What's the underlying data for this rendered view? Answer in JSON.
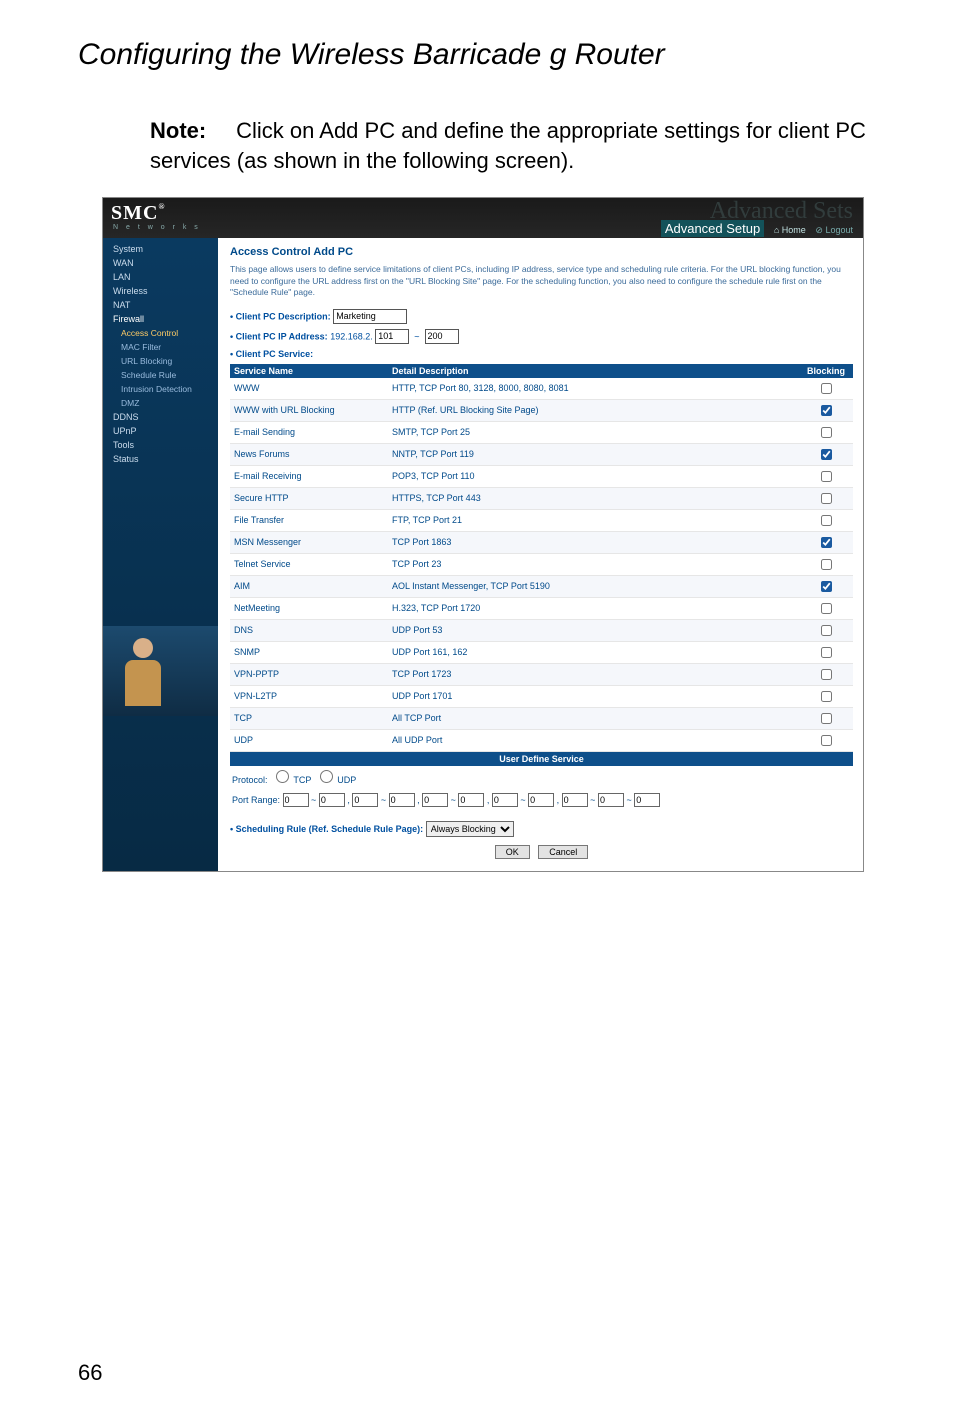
{
  "page": {
    "title": "Configuring the Wireless Barricade g Router",
    "note_label": "Note:",
    "note_text": "Click on Add PC and define the appropriate settings for client PC services (as shown in the following screen).",
    "page_number": "66"
  },
  "header": {
    "logo": "SMC",
    "logo_sup": "®",
    "networks": "N e t w o r k s",
    "ghost": "Advanced Sets",
    "setup": "Advanced Setup",
    "home": "Home",
    "logout": "Logout"
  },
  "nav": {
    "items": [
      "System",
      "WAN",
      "LAN",
      "Wireless",
      "NAT",
      "Firewall"
    ],
    "firewall_sub": [
      "Access Control",
      "MAC Filter",
      "URL Blocking",
      "Schedule Rule",
      "Intrusion Detection",
      "DMZ"
    ],
    "items_after": [
      "DDNS",
      "UPnP",
      "Tools",
      "Status"
    ]
  },
  "main": {
    "heading": "Access Control Add PC",
    "desc": "This page allows users to define service limitations of client PCs, including IP address, service type and scheduling rule criteria. For the URL blocking function, you need to configure the URL address first on the \"URL Blocking Site\" page. For the scheduling function, you also need to configure the schedule rule first on the \"Schedule Rule\" page.",
    "client_desc_label": "• Client PC Description:",
    "client_desc_value": "Marketing",
    "client_ip_label": "• Client PC IP Address:",
    "client_ip_prefix": "192.168.2.",
    "client_ip_from": "101",
    "client_ip_to": "200",
    "client_service_label": "• Client PC Service:",
    "th_service": "Service Name",
    "th_detail": "Detail Description",
    "th_block": "Blocking",
    "services": [
      {
        "name": "WWW",
        "detail": "HTTP, TCP Port 80, 3128, 8000, 8080, 8081",
        "blk": false
      },
      {
        "name": "WWW with URL Blocking",
        "detail": "HTTP (Ref. URL Blocking Site Page)",
        "blk": true
      },
      {
        "name": "E-mail Sending",
        "detail": "SMTP, TCP Port 25",
        "blk": false
      },
      {
        "name": "News Forums",
        "detail": "NNTP, TCP Port 119",
        "blk": true
      },
      {
        "name": "E-mail Receiving",
        "detail": "POP3, TCP Port 110",
        "blk": false
      },
      {
        "name": "Secure HTTP",
        "detail": "HTTPS, TCP Port 443",
        "blk": false
      },
      {
        "name": "File Transfer",
        "detail": "FTP, TCP Port 21",
        "blk": false
      },
      {
        "name": "MSN Messenger",
        "detail": "TCP Port 1863",
        "blk": true
      },
      {
        "name": "Telnet Service",
        "detail": "TCP Port 23",
        "blk": false
      },
      {
        "name": "AIM",
        "detail": "AOL Instant Messenger, TCP Port 5190",
        "blk": true
      },
      {
        "name": "NetMeeting",
        "detail": "H.323, TCP Port 1720",
        "blk": false
      },
      {
        "name": "DNS",
        "detail": "UDP Port 53",
        "blk": false
      },
      {
        "name": "SNMP",
        "detail": "UDP Port 161, 162",
        "blk": false
      },
      {
        "name": "VPN-PPTP",
        "detail": "TCP Port 1723",
        "blk": false
      },
      {
        "name": "VPN-L2TP",
        "detail": "UDP Port 1701",
        "blk": false
      },
      {
        "name": "TCP",
        "detail": "All TCP Port",
        "blk": false
      },
      {
        "name": "UDP",
        "detail": "All UDP Port",
        "blk": false
      }
    ],
    "uds_title": "User Define Service",
    "protocol_label": "Protocol:",
    "tcp": "TCP",
    "udp": "UDP",
    "port_range_label": "Port Range:",
    "pr_default": "0",
    "sched_label": "• Scheduling Rule (Ref. Schedule Rule Page):",
    "sched_value": "Always Blocking",
    "ok": "OK",
    "cancel": "Cancel"
  }
}
